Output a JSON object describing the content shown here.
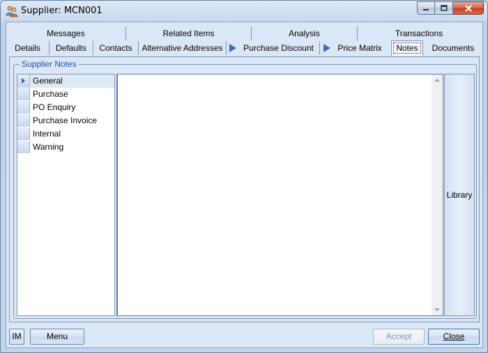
{
  "window": {
    "title": "Supplier: MCN001"
  },
  "tabs_row1": [
    {
      "label": "Messages"
    },
    {
      "label": "Related Items"
    },
    {
      "label": "Analysis"
    },
    {
      "label": "Transactions"
    }
  ],
  "tabs_row2": [
    {
      "label": "Details"
    },
    {
      "label": "Defaults"
    },
    {
      "label": "Contacts"
    },
    {
      "label": "Alternative Addresses"
    },
    {
      "label": "Purchase Discount"
    },
    {
      "label": "Price Matrix"
    },
    {
      "label": "Notes"
    },
    {
      "label": "Documents"
    }
  ],
  "active_tab": "Notes",
  "notes": {
    "group_label": "Supplier Notes",
    "categories": [
      {
        "label": "General"
      },
      {
        "label": "Purchase"
      },
      {
        "label": "PO Enquiry"
      },
      {
        "label": "Purchase Invoice"
      },
      {
        "label": "Internal"
      },
      {
        "label": "Warning"
      }
    ],
    "selected_category": "General",
    "editor_text": "",
    "library_label": "Library"
  },
  "footer": {
    "im_label": "IM",
    "menu_label": "Menu",
    "accept_label": "Accept",
    "close_label": "Close"
  }
}
